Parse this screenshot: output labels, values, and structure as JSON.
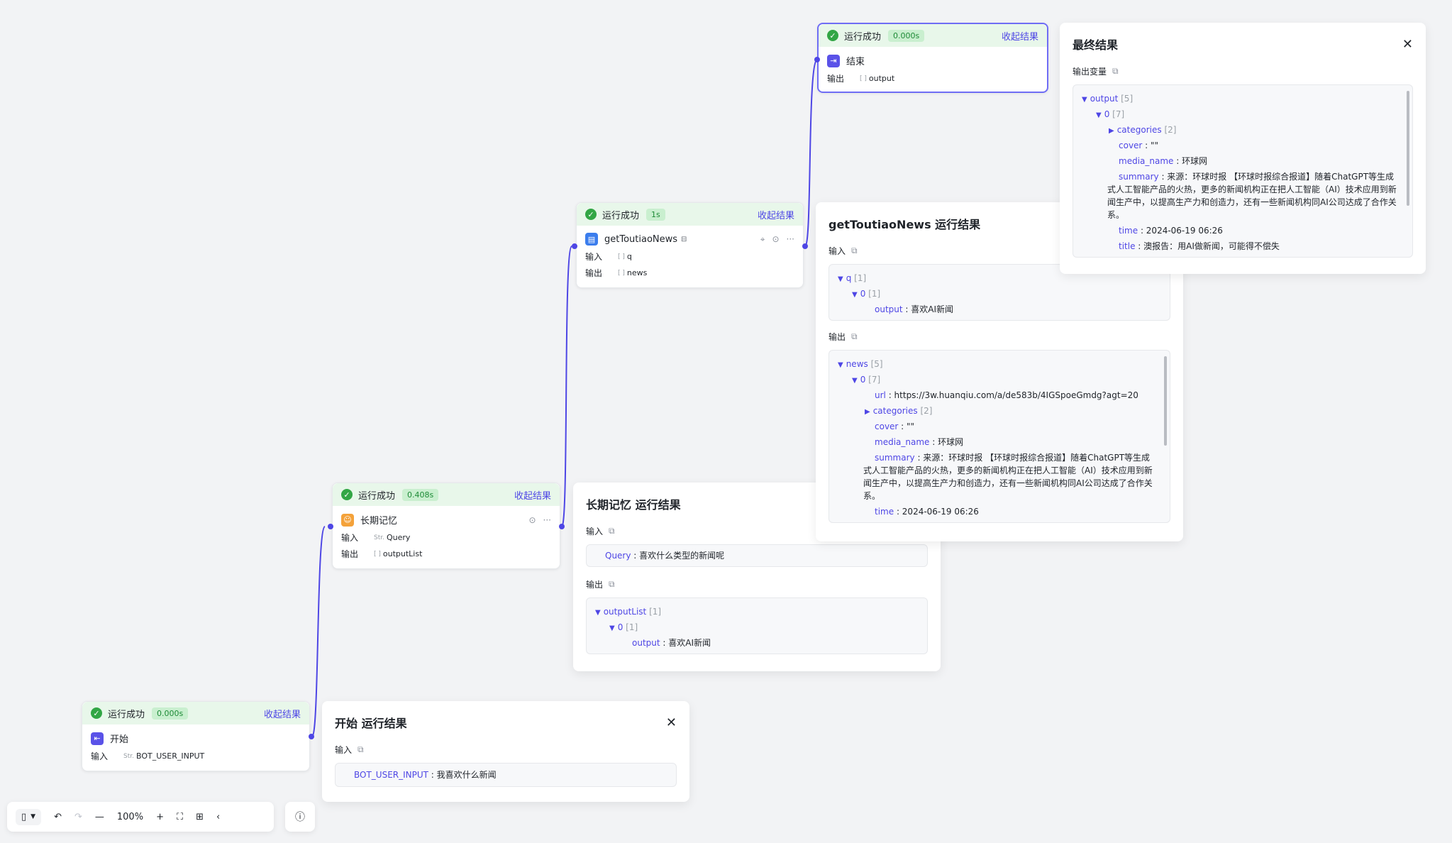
{
  "colors": {
    "accent": "#4e46e5",
    "success": "#32a645",
    "status_bg": "#e8f7ea"
  },
  "nodes": {
    "end": {
      "status": "运行成功",
      "time": "0.000s",
      "collapse": "收起结果",
      "title": "结束",
      "output_label": "输出",
      "output_value": "output"
    },
    "news": {
      "status": "运行成功",
      "time": "1s",
      "collapse": "收起结果",
      "title": "getToutiaoNews",
      "input_label": "输入",
      "input_value": "q",
      "output_label": "输出",
      "output_value": "news"
    },
    "mem": {
      "status": "运行成功",
      "time": "0.408s",
      "collapse": "收起结果",
      "title": "长期记忆",
      "input_label": "输入",
      "input_type": "Str.",
      "input_value": "Query",
      "output_label": "输出",
      "output_value": "outputList"
    },
    "start": {
      "status": "运行成功",
      "time": "0.000s",
      "collapse": "收起结果",
      "title": "开始",
      "input_label": "输入",
      "input_type": "Str.",
      "input_value": "BOT_USER_INPUT"
    }
  },
  "final_panel": {
    "title": "最终结果",
    "section": "输出变量",
    "root_key": "output",
    "root_count": "[5]",
    "item_key": "0",
    "item_count": "[7]",
    "categories_key": "categories",
    "categories_count": "[2]",
    "cover_key": "cover",
    "cover_value": "\"\"",
    "media_key": "media_name",
    "media_value": "环球网",
    "summary_key": "summary",
    "summary_value": "来源：环球时报 【环球时报综合报道】随着ChatGPT等生成式人工智能产品的火热，更多的新闻机构正在把人工智能（AI）技术应用到新闻生产中，以提高生产力和创造力，还有一些新闻机构同AI公司达成了合作关系。",
    "time_key": "time",
    "time_value": "2024-06-19 06:26",
    "title_key": "title",
    "title_value": "澳报告：用AI做新闻，可能得不偿失"
  },
  "news_panel": {
    "title": "getToutiaoNews 运行结果",
    "input_label": "输入",
    "q_key": "q",
    "q_count": "[1]",
    "q0_key": "0",
    "q0_count": "[1]",
    "q_output_key": "output",
    "q_output_value": "喜欢AI新闻",
    "output_label": "输出",
    "news_key": "news",
    "news_count": "[5]",
    "item_key": "0",
    "item_count": "[7]",
    "url_key": "url",
    "url_value": "https://3w.huanqiu.com/a/de583b/4IGSpoeGmdg?agt=20",
    "categories_key": "categories",
    "categories_count": "[2]",
    "cover_key": "cover",
    "cover_value": "\"\"",
    "media_key": "media_name",
    "media_value": "环球网",
    "summary_key": "summary",
    "summary_value": "来源：环球时报 【环球时报综合报道】随着ChatGPT等生成式人工智能产品的火热，更多的新闻机构正在把人工智能（AI）技术应用到新闻生产中，以提高生产力和创造力，还有一些新闻机构同AI公司达成了合作关系。",
    "time_key": "time",
    "time_value": "2024-06-19 06:26"
  },
  "mem_panel": {
    "title": "长期记忆 运行结果",
    "input_label": "输入",
    "query_key": "Query",
    "query_value": "喜欢什么类型的新闻呢",
    "output_label": "输出",
    "list_key": "outputList",
    "list_count": "[1]",
    "item_key": "0",
    "item_count": "[1]",
    "out_key": "output",
    "out_value": "喜欢AI新闻"
  },
  "start_panel": {
    "title": "开始 运行结果",
    "input_label": "输入",
    "var_key": "BOT_USER_INPUT",
    "var_value": "我喜欢什么新闻"
  },
  "toolbar": {
    "zoom": "100%"
  }
}
